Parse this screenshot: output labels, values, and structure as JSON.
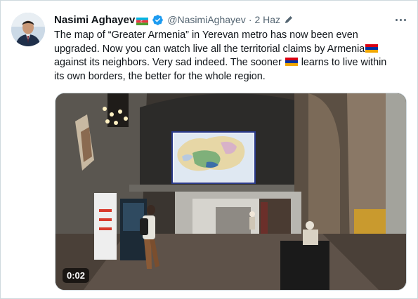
{
  "author": {
    "display_name": "Nasimi Aghayev",
    "handle": "@NasimiAghayev",
    "separator": "·",
    "date": "2 Haz"
  },
  "tweet": {
    "line1": "The map of “Greater Armenia” in Yerevan metro has now been even",
    "line2": "upgraded. Now you can watch live all the territorial claims by Armenia",
    "line3": "against its neighbors. Very sad indeed. The sooner",
    "line3_after": "learns to live within",
    "line4": "its own borders, the better for the whole region."
  },
  "media": {
    "video_time": "0:02"
  },
  "icons": {
    "azerbaijan_flag": "azerbaijan-flag-icon",
    "verified": "verified-badge-icon",
    "edit": "pencil-edit-icon",
    "more": "more-options-icon",
    "armenia_flag": "armenia-flag-icon"
  },
  "colors": {
    "accent": "#1d9bf0",
    "text_primary": "#0f1419",
    "text_secondary": "#536471"
  }
}
